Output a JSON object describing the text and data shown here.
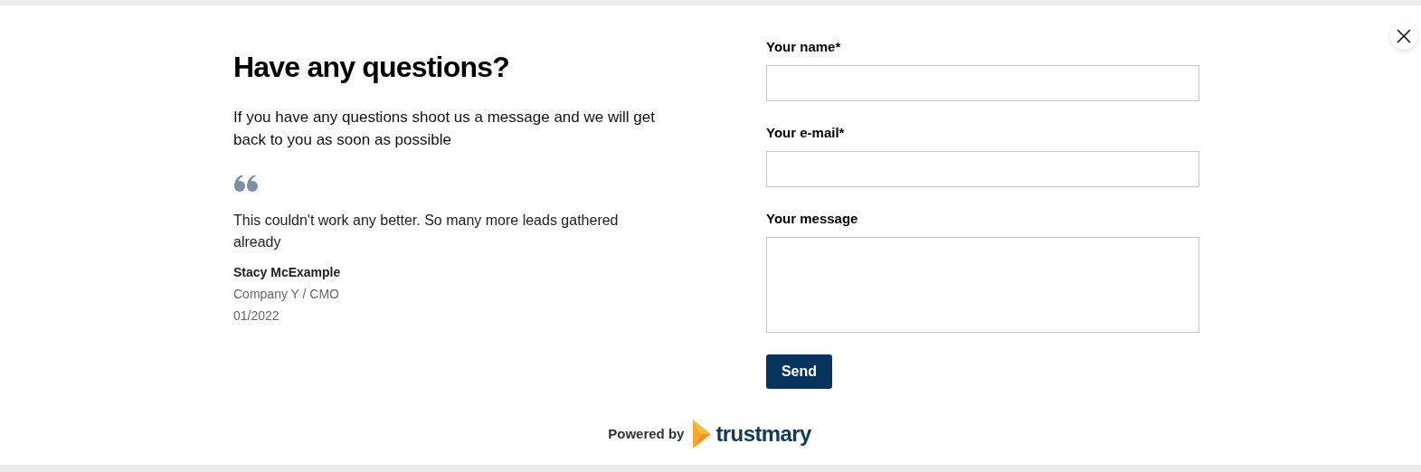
{
  "title": "Have any questions?",
  "intro": "If you have any questions shoot us a message and we will get back to you as soon as possible",
  "testimonial": {
    "quote": "This couldn't work any better. So many more leads gathered already",
    "author": "Stacy McExample",
    "role": "Company Y / CMO",
    "date": "01/2022"
  },
  "form": {
    "fields": [
      {
        "label": "Your name*",
        "kind": "text"
      },
      {
        "label": "Your e-mail*",
        "kind": "text"
      },
      {
        "label": "Your message",
        "kind": "textarea"
      }
    ],
    "submit": "Send"
  },
  "footer": {
    "powered_by": "Powered by",
    "brand": "trustmary"
  }
}
